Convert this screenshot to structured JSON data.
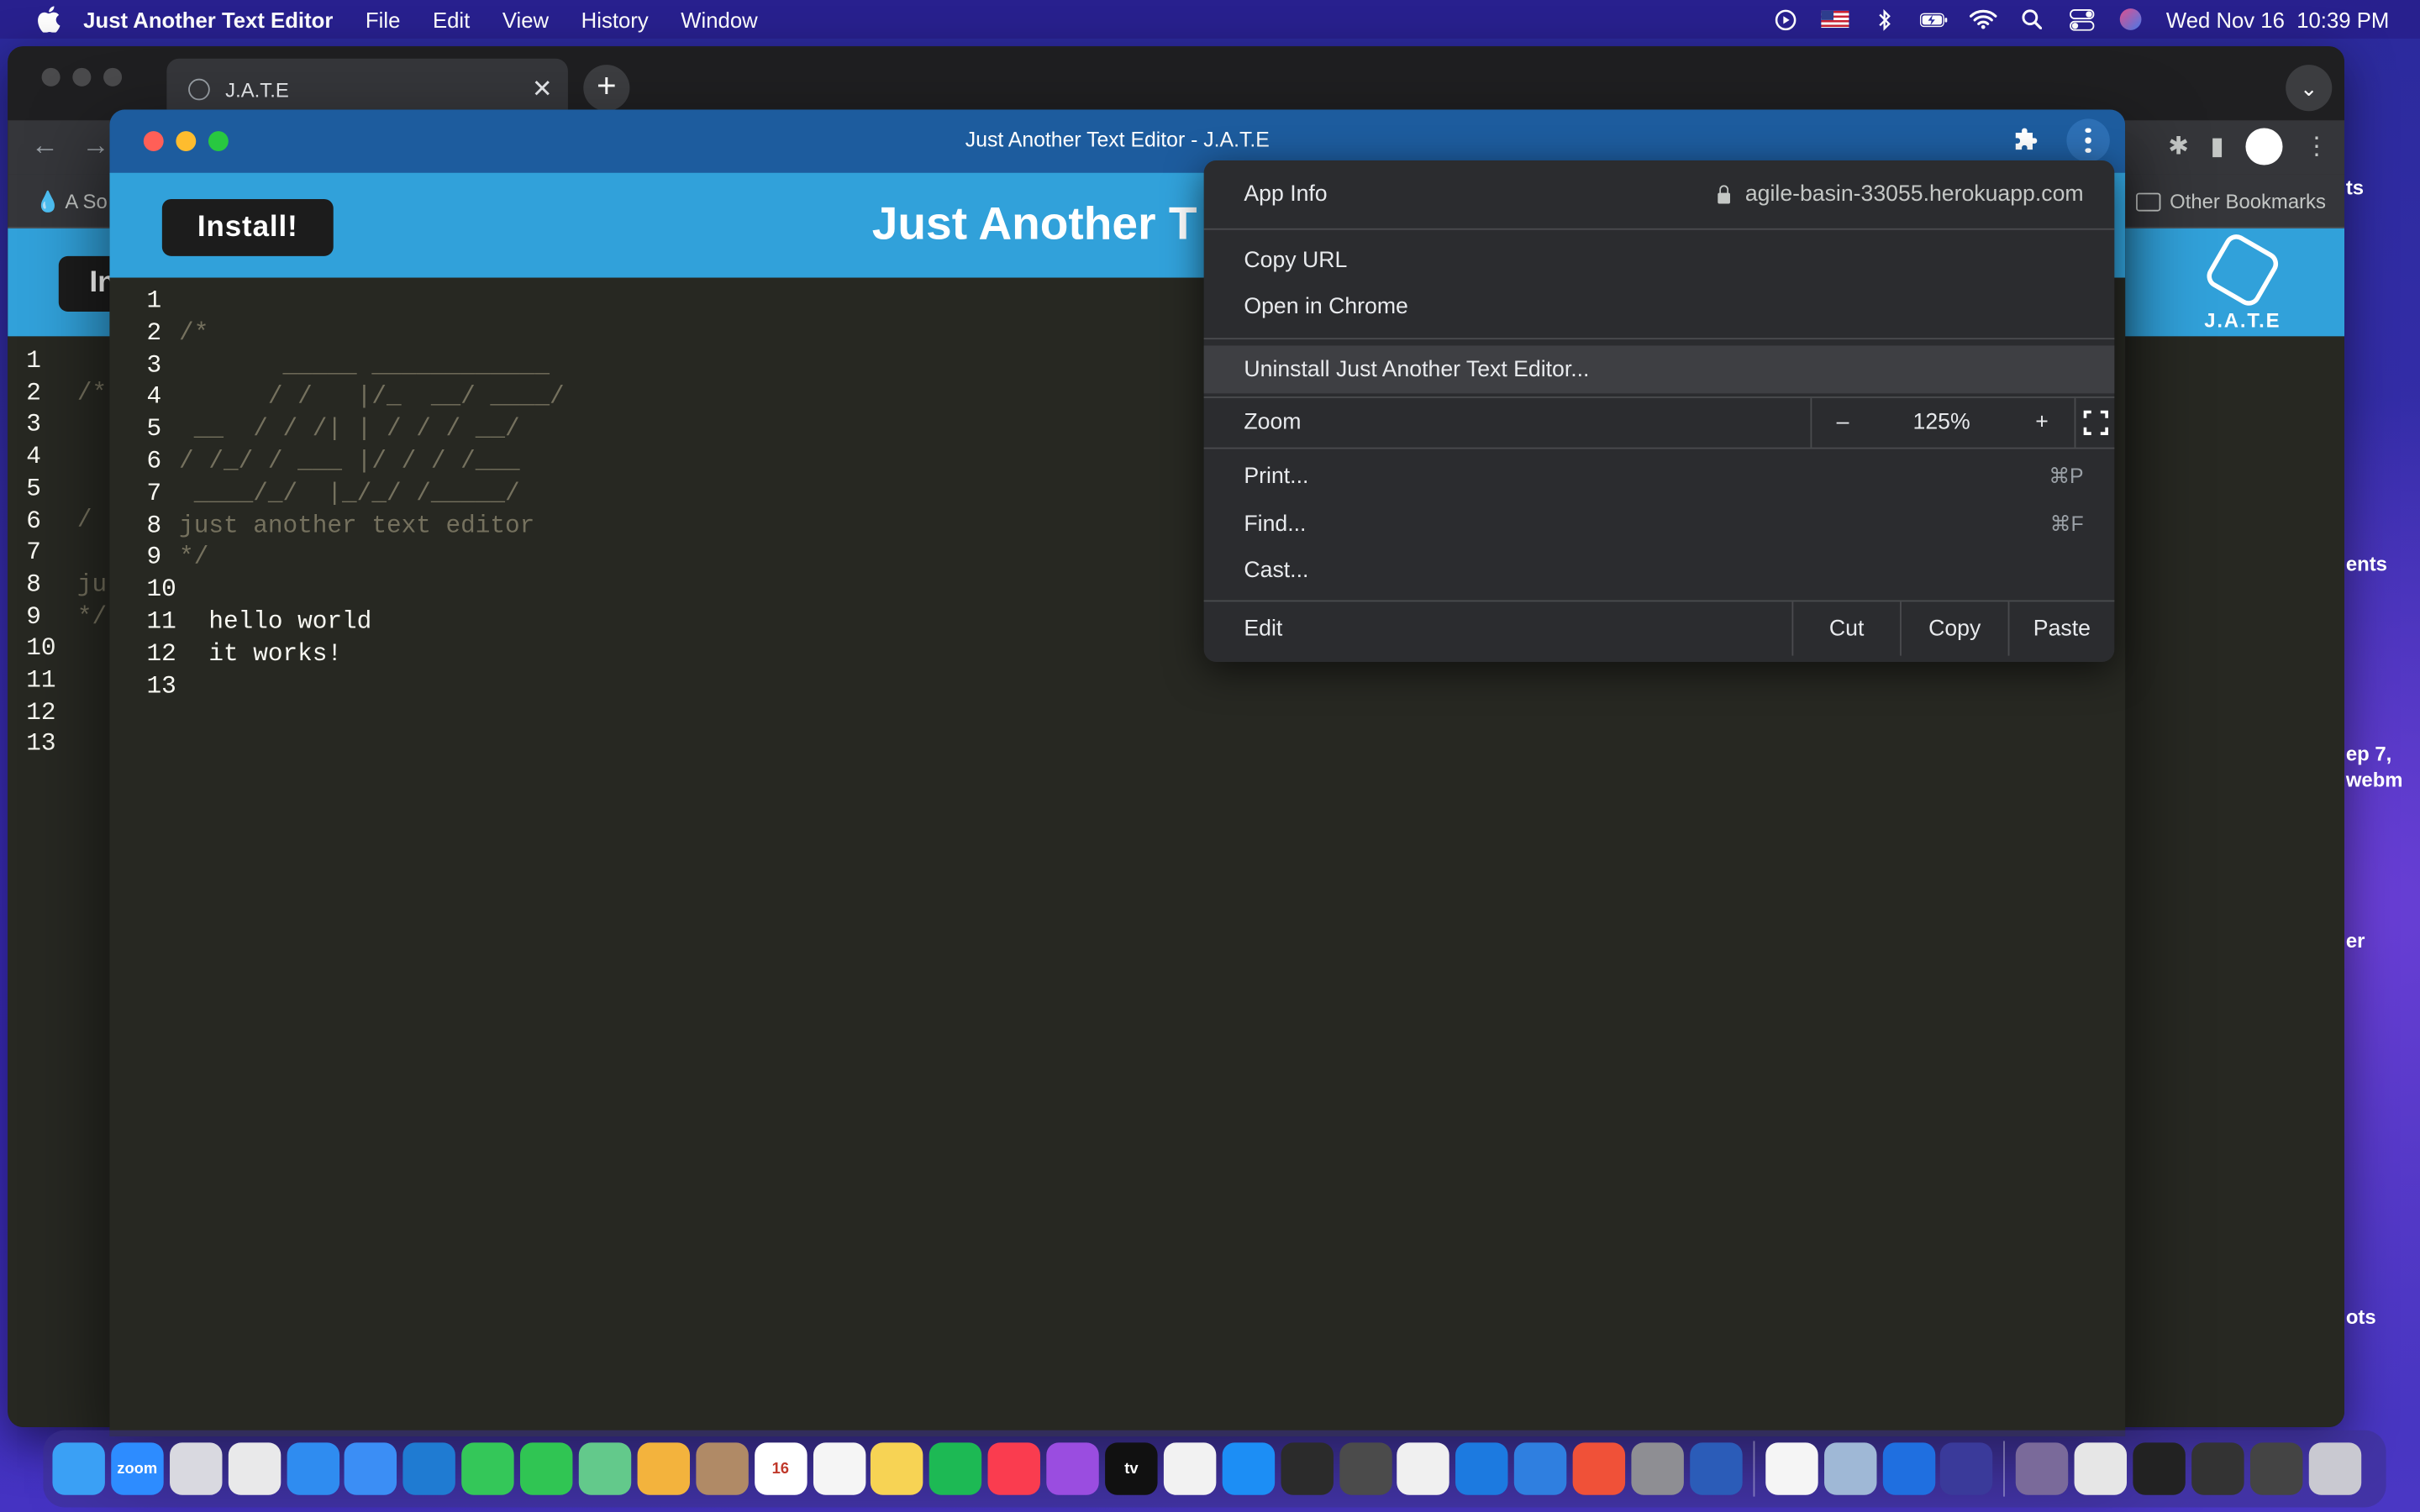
{
  "menubar": {
    "app_name": "Just Another Text Editor",
    "menus": [
      "File",
      "Edit",
      "View",
      "History",
      "Window"
    ],
    "datetime": "Wed Nov 16  10:39 PM"
  },
  "bg_window": {
    "tab_title": "J.A.T.E",
    "bookmark_left": "A So",
    "bookmark_right": "Other Bookmarks",
    "install_label": "In",
    "logo_text": "J.A.T.E",
    "line_numbers": [
      "1",
      "2",
      "3",
      "4",
      "5",
      "6",
      "7",
      "8",
      "9",
      "10",
      "11",
      "12",
      "13"
    ],
    "code": [
      "",
      "/*",
      "",
      "",
      "",
      "/",
      "",
      "ju",
      "*/",
      "",
      "",
      "",
      ""
    ]
  },
  "desktop": {
    "labels": [
      "ts",
      "ents",
      "ep 7,",
      "webm",
      "er",
      "ots"
    ]
  },
  "app": {
    "window_title": "Just Another Text Editor - J.A.T.E",
    "install_label": "Install!",
    "header_title": "Just Another T",
    "line_numbers": [
      "1",
      "2",
      "3",
      "4",
      "5",
      "6",
      "7",
      "8",
      "9",
      "10",
      "11",
      "12",
      "13"
    ],
    "code_lines": [
      {
        "text": "",
        "style": "comment"
      },
      {
        "text": "/*",
        "style": "comment"
      },
      {
        "text": "       _____ ____________",
        "style": "comment"
      },
      {
        "text": "      / /   |/_  __/ ____/",
        "style": "comment"
      },
      {
        "text": " __  / / /| | / / / __/",
        "style": "comment"
      },
      {
        "text": "/ /_/ / ___ |/ / / /___",
        "style": "comment"
      },
      {
        "text": " ____/_/  |_/_/ /_____/",
        "style": "comment"
      },
      {
        "text": "just another text editor",
        "style": "comment"
      },
      {
        "text": "*/",
        "style": "comment"
      },
      {
        "text": "",
        "style": "plain"
      },
      {
        "text": "  hello world",
        "style": "plain"
      },
      {
        "text": "  it works!",
        "style": "plain"
      },
      {
        "text": "",
        "style": "plain"
      }
    ]
  },
  "menu": {
    "app_info": "App Info",
    "url": "agile-basin-33055.herokuapp.com",
    "copy_url": "Copy URL",
    "open_in_chrome": "Open in Chrome",
    "uninstall": "Uninstall Just Another Text Editor...",
    "zoom_label": "Zoom",
    "zoom_minus": "–",
    "zoom_value": "125%",
    "zoom_plus": "+",
    "print": "Print...",
    "print_shortcut": "⌘P",
    "find": "Find...",
    "find_shortcut": "⌘F",
    "cast": "Cast...",
    "edit": "Edit",
    "cut": "Cut",
    "copy": "Copy",
    "paste": "Paste"
  },
  "dock": {
    "apps": [
      {
        "name": "finder-icon",
        "color": "#3aa0f5"
      },
      {
        "name": "zoom-icon",
        "color": "#2d8cff",
        "label": "zoom"
      },
      {
        "name": "launchpad-icon",
        "color": "#d9d9e0"
      },
      {
        "name": "chrome-icon",
        "color": "#e9e9ea"
      },
      {
        "name": "safari-icon",
        "color": "#2f8cf0"
      },
      {
        "name": "mail-icon",
        "color": "#3b8ef5"
      },
      {
        "name": "vscode-icon",
        "color": "#1f7bd2"
      },
      {
        "name": "facetime-icon",
        "color": "#34c759"
      },
      {
        "name": "messages-icon",
        "color": "#30c553"
      },
      {
        "name": "maps-icon",
        "color": "#63c98b"
      },
      {
        "name": "photos-icon",
        "color": "#f3b33d"
      },
      {
        "name": "contacts-icon",
        "color": "#b08a66"
      },
      {
        "name": "calendar-icon",
        "color": "#ffffff",
        "label": "16"
      },
      {
        "name": "reminders-icon",
        "color": "#f5f5f5"
      },
      {
        "name": "notes-icon",
        "color": "#f7d354"
      },
      {
        "name": "spotify-icon",
        "color": "#1db954"
      },
      {
        "name": "music-icon",
        "color": "#fa3c4f"
      },
      {
        "name": "podcasts-icon",
        "color": "#9a4de0"
      },
      {
        "name": "tv-icon",
        "color": "#111111",
        "label": "tv"
      },
      {
        "name": "news-icon",
        "color": "#f2f2f2"
      },
      {
        "name": "app-store-icon",
        "color": "#1c8ef5"
      },
      {
        "name": "terminal-icon",
        "color": "#2b2b2b"
      },
      {
        "name": "sublime-icon",
        "color": "#4b4b4b"
      },
      {
        "name": "instruments-icon",
        "color": "#f0f0f0"
      },
      {
        "name": "xcode-icon",
        "color": "#1c7ae0"
      },
      {
        "name": "simulator-icon",
        "color": "#2f7fe0"
      },
      {
        "name": "swift-icon",
        "color": "#f05138"
      },
      {
        "name": "system-preferences-icon",
        "color": "#8e8e93"
      },
      {
        "name": "word-icon",
        "color": "#2b5cb8"
      },
      {
        "name": "slack-icon",
        "color": "#f5f5f5"
      },
      {
        "name": "preview-icon",
        "color": "#9fb8d6"
      },
      {
        "name": "maps-pin-icon",
        "color": "#1f6fe0"
      },
      {
        "name": "jate-icon",
        "color": "#3a3a9a"
      },
      {
        "name": "downloads-stack-icon",
        "color": "#7a6a9a"
      },
      {
        "name": "document-icon",
        "color": "#e6e6e6"
      },
      {
        "name": "screen-icon",
        "color": "#222222"
      },
      {
        "name": "window-thumbnail-icon",
        "color": "#333333"
      },
      {
        "name": "window-thumbnail-2-icon",
        "color": "#444444"
      },
      {
        "name": "trash-icon",
        "color": "#c9c9d1"
      }
    ]
  }
}
